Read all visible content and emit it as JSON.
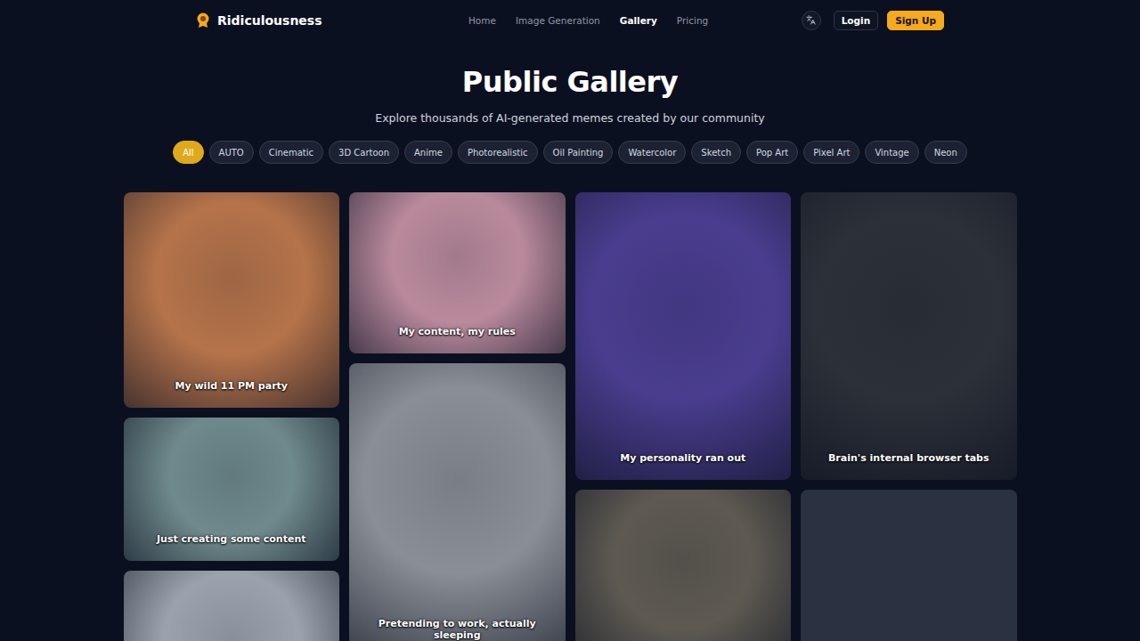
{
  "header": {
    "brand": "Ridiculousness",
    "nav": [
      {
        "label": "Home",
        "selected": false
      },
      {
        "label": "Image Generation",
        "selected": false
      },
      {
        "label": "Gallery",
        "selected": true
      },
      {
        "label": "Pricing",
        "selected": false
      }
    ],
    "login": "Login",
    "signup": "Sign Up"
  },
  "hero": {
    "title": "Public Gallery",
    "subtitle": "Explore thousands of AI-generated memes created by our community"
  },
  "filters": [
    {
      "label": "All",
      "selected": true
    },
    {
      "label": "AUTO",
      "selected": false
    },
    {
      "label": "Cinematic",
      "selected": false
    },
    {
      "label": "3D Cartoon",
      "selected": false
    },
    {
      "label": "Anime",
      "selected": false
    },
    {
      "label": "Photorealistic",
      "selected": false
    },
    {
      "label": "Oil Painting",
      "selected": false
    },
    {
      "label": "Watercolor",
      "selected": false
    },
    {
      "label": "Sketch",
      "selected": false
    },
    {
      "label": "Pop Art",
      "selected": false
    },
    {
      "label": "Pixel Art",
      "selected": false
    },
    {
      "label": "Vintage",
      "selected": false
    },
    {
      "label": "Neon",
      "selected": false
    }
  ],
  "gallery": {
    "columns": [
      [
        {
          "kind": "image",
          "caption": "My wild 11 PM party",
          "color": "#b5734a"
        },
        {
          "kind": "image",
          "caption": "Just creating some content",
          "color": "#6f8a8c"
        },
        {
          "kind": "image",
          "color": "#9aa3ad"
        }
      ],
      [
        {
          "kind": "image",
          "caption": "My content, my rules",
          "color": "#b98a9c"
        },
        {
          "kind": "image",
          "caption": "Pretending to work, actually sleeping",
          "color": "#8a8f96"
        }
      ],
      [
        {
          "kind": "image",
          "caption": "My personality ran out",
          "color": "#4a3d8f"
        },
        {
          "kind": "image",
          "color": "#5e5a52"
        }
      ],
      [
        {
          "kind": "image",
          "caption": "Brain's internal browser tabs",
          "color": "#2c3038"
        },
        {
          "kind": "loading"
        }
      ]
    ]
  }
}
